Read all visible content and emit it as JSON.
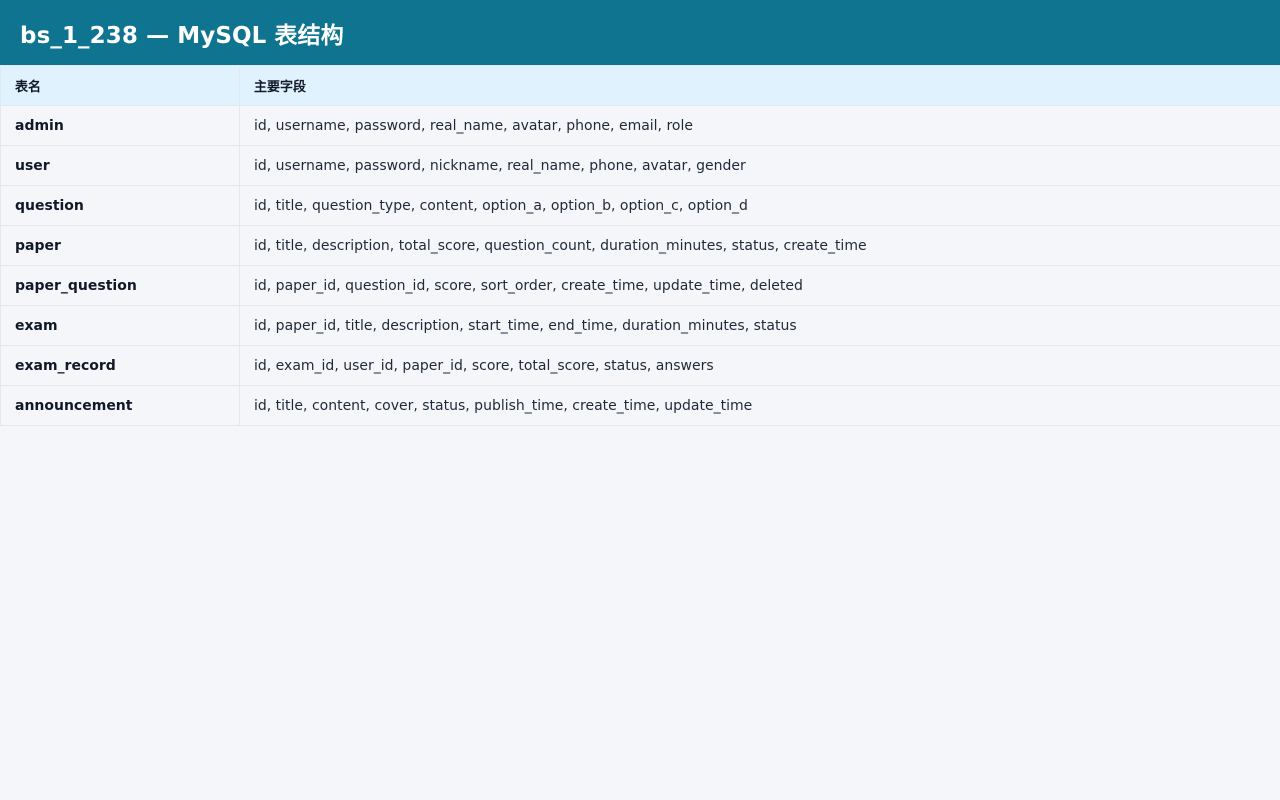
{
  "header": {
    "title": "bs_1_238 — MySQL 表结构"
  },
  "table": {
    "columns": [
      "表名",
      "主要字段"
    ],
    "rows": [
      {
        "name": "admin",
        "fields": "id, username, password, real_name, avatar, phone, email, role"
      },
      {
        "name": "user",
        "fields": "id, username, password, nickname, real_name, phone, avatar, gender"
      },
      {
        "name": "question",
        "fields": "id, title, question_type, content, option_a, option_b, option_c, option_d"
      },
      {
        "name": "paper",
        "fields": "id, title, description, total_score, question_count, duration_minutes, status, create_time"
      },
      {
        "name": "paper_question",
        "fields": "id, paper_id, question_id, score, sort_order, create_time, update_time, deleted"
      },
      {
        "name": "exam",
        "fields": "id, paper_id, title, description, start_time, end_time, duration_minutes, status"
      },
      {
        "name": "exam_record",
        "fields": "id, exam_id, user_id, paper_id, score, total_score, status, answers"
      },
      {
        "name": "announcement",
        "fields": "id, title, content, cover, status, publish_time, create_time, update_time"
      }
    ]
  }
}
